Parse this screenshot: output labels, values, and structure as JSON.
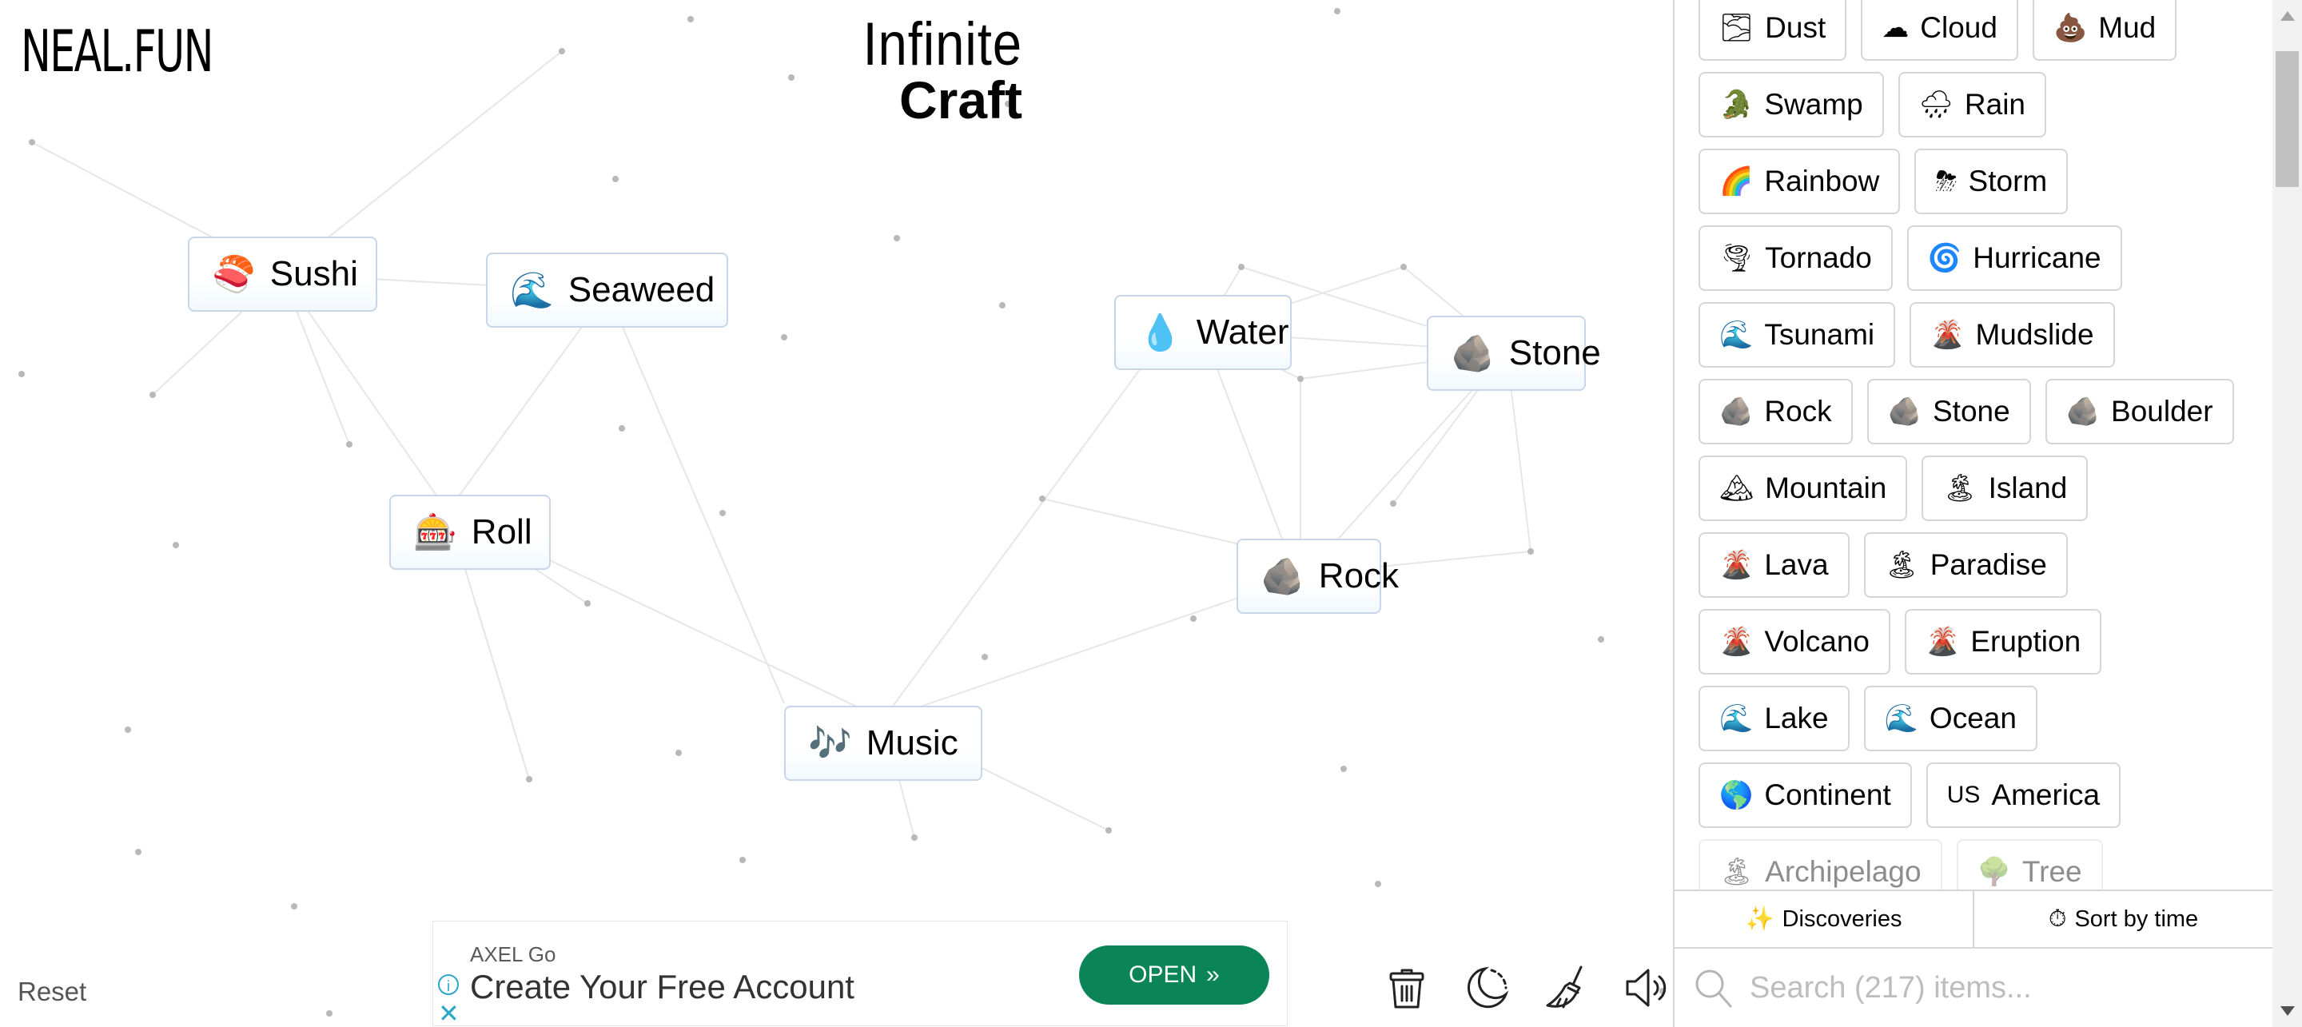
{
  "header": {
    "site_logo": "NEAL.FUN",
    "game_title_line1": "Infinite",
    "game_title_line2": "Craft"
  },
  "canvas_items": [
    {
      "emoji": "🍣",
      "label": "Sushi"
    },
    {
      "emoji": "🌊",
      "label": "Seaweed"
    },
    {
      "emoji": "🎰",
      "label": "Roll"
    },
    {
      "emoji": "💧",
      "label": "Water"
    },
    {
      "emoji": "🪨",
      "label": "Stone"
    },
    {
      "emoji": "🪨",
      "label": "Rock"
    },
    {
      "emoji": "🎶",
      "label": "Music"
    }
  ],
  "bottom_bar": {
    "reset_label": "Reset",
    "tools": [
      "trash-icon",
      "dark-mode-moon-icon",
      "broom-clear-icon",
      "sound-speaker-icon"
    ]
  },
  "ad": {
    "brand": "AXEL Go",
    "headline": "Create Your Free Account",
    "cta": "OPEN",
    "cta_icon": "»"
  },
  "sidebar": {
    "items": [
      {
        "emoji": "🌫",
        "label": "Dust"
      },
      {
        "emoji": "☁",
        "label": "Cloud"
      },
      {
        "emoji": "💩",
        "label": "Mud"
      },
      {
        "emoji": "🐊",
        "label": "Swamp"
      },
      {
        "emoji": "🌧",
        "label": "Rain"
      },
      {
        "emoji": "🌈",
        "label": "Rainbow"
      },
      {
        "emoji": "⛈",
        "label": "Storm"
      },
      {
        "emoji": "🌪",
        "label": "Tornado"
      },
      {
        "emoji": "🌀",
        "label": "Hurricane"
      },
      {
        "emoji": "🌊",
        "label": "Tsunami"
      },
      {
        "emoji": "🌋",
        "label": "Mudslide"
      },
      {
        "emoji": "🪨",
        "label": "Rock"
      },
      {
        "emoji": "🪨",
        "label": "Stone"
      },
      {
        "emoji": "🪨",
        "label": "Boulder"
      },
      {
        "emoji": "🏔",
        "label": "Mountain"
      },
      {
        "emoji": "🏝",
        "label": "Island"
      },
      {
        "emoji": "🌋",
        "label": "Lava"
      },
      {
        "emoji": "🏝",
        "label": "Paradise"
      },
      {
        "emoji": "🌋",
        "label": "Volcano"
      },
      {
        "emoji": "🌋",
        "label": "Eruption"
      },
      {
        "emoji": "🌊",
        "label": "Lake"
      },
      {
        "emoji": "🌊",
        "label": "Ocean"
      },
      {
        "emoji": "🌎",
        "label": "Continent"
      },
      {
        "emoji": "US",
        "label": "America"
      },
      {
        "emoji": "🏝",
        "label": "Archipelago"
      },
      {
        "emoji": "🌳",
        "label": "Tree"
      }
    ],
    "discoveries_label": "Discoveries",
    "sort_label": "Sort by time",
    "search_placeholder": "Search (217) items...",
    "search_value": ""
  }
}
